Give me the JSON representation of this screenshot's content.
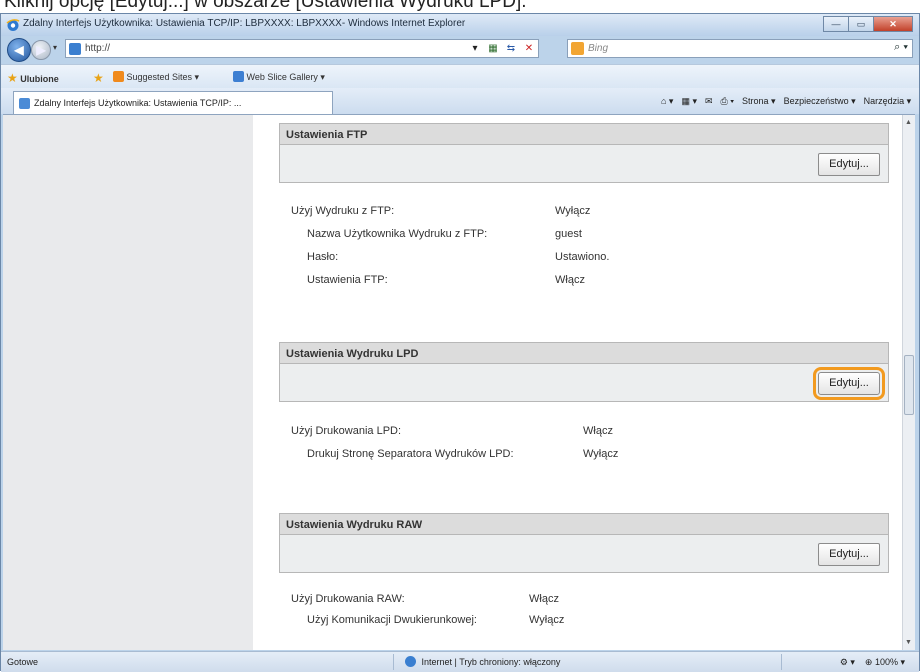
{
  "caption": "Kliknij opcję [Edytuj...] w obszarze [Ustawienia Wydruku LPD].",
  "window": {
    "title": "Zdalny Interfejs Użytkownika: Ustawienia TCP/IP: LBPXXXX: LBPXXXX- Windows Internet Explorer",
    "minimize": "—",
    "maximize": "▭",
    "close": "✕"
  },
  "address": {
    "url": "http://",
    "search_placeholder": "Bing",
    "refresh": "⟳",
    "stop": "✕",
    "go": "⇆",
    "dropdown": "▾"
  },
  "favorites": {
    "label": "Ulubione",
    "items": [
      "Suggested Sites ▾",
      "Web Slice Gallery ▾"
    ]
  },
  "tab": {
    "label": "Zdalny Interfejs Użytkownika: Ustawienia TCP/IP: ..."
  },
  "command_bar": {
    "items": [
      "⌂ ▾",
      "▦ ▾",
      "✉",
      "⎙ ▾",
      "Strona ▾",
      "Bezpieczeństwo ▾",
      "Narzędzia ▾",
      "❓ ▾"
    ]
  },
  "sections": {
    "ftp": {
      "title": "Ustawienia FTP",
      "edit": "Edytuj...",
      "rows": [
        {
          "label": "Użyj Wydruku z FTP:",
          "value": "Wyłącz"
        },
        {
          "label": "Nazwa Użytkownika Wydruku z FTP:",
          "value": "guest"
        },
        {
          "label": "Hasło:",
          "value": "Ustawiono."
        },
        {
          "label": "Ustawienia FTP:",
          "value": "Włącz"
        }
      ]
    },
    "lpd": {
      "title": "Ustawienia Wydruku LPD",
      "edit": "Edytuj...",
      "rows": [
        {
          "label": "Użyj Drukowania LPD:",
          "value": "Włącz"
        },
        {
          "label": "Drukuj Stronę Separatora Wydruków LPD:",
          "value": "Wyłącz"
        }
      ]
    },
    "raw": {
      "title": "Ustawienia Wydruku RAW",
      "edit": "Edytuj...",
      "rows": [
        {
          "label": "Użyj Drukowania RAW:",
          "value": "Włącz"
        },
        {
          "label": "Użyj Komunikacji Dwukierunkowej:",
          "value": "Wyłącz"
        }
      ]
    }
  },
  "status": {
    "left": "Gotowe",
    "zone": "Internet | Tryb chroniony: włączony",
    "zoom": "100%",
    "zoom_control": "⊕ 100% ▾",
    "protect": "⚙ ▾"
  }
}
